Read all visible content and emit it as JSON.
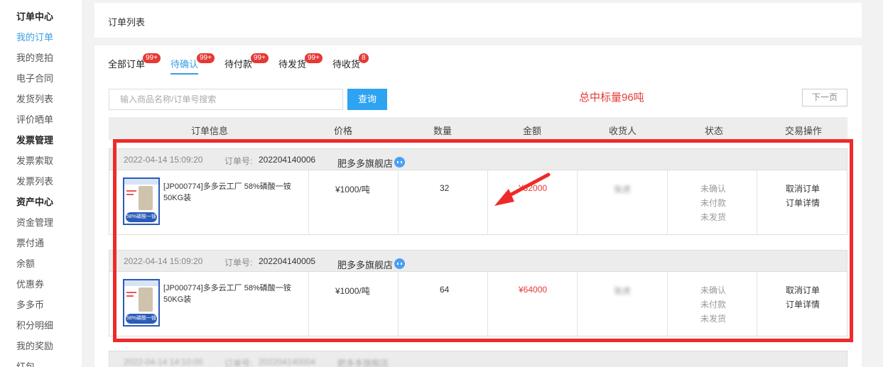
{
  "sidebar": {
    "items": [
      {
        "label": "订单中心",
        "type": "header"
      },
      {
        "label": "我的订单",
        "type": "active"
      },
      {
        "label": "我的竞拍",
        "type": "item"
      },
      {
        "label": "电子合同",
        "type": "item"
      },
      {
        "label": "发货列表",
        "type": "item"
      },
      {
        "label": "评价晒单",
        "type": "item"
      },
      {
        "label": "发票管理",
        "type": "header"
      },
      {
        "label": "发票索取",
        "type": "item"
      },
      {
        "label": "发票列表",
        "type": "item"
      },
      {
        "label": "资产中心",
        "type": "header"
      },
      {
        "label": "资金管理",
        "type": "item"
      },
      {
        "label": "票付通",
        "type": "item"
      },
      {
        "label": "余额",
        "type": "item"
      },
      {
        "label": "优惠券",
        "type": "item"
      },
      {
        "label": "多多币",
        "type": "item"
      },
      {
        "label": "积分明细",
        "type": "item"
      },
      {
        "label": "我的奖励",
        "type": "item"
      },
      {
        "label": "红包",
        "type": "item"
      }
    ]
  },
  "page": {
    "title": "订单列表"
  },
  "tabs": [
    {
      "label": "全部订单",
      "badge": "99+"
    },
    {
      "label": "待确认",
      "badge": "99+",
      "active": true
    },
    {
      "label": "待付款",
      "badge": "99+"
    },
    {
      "label": "待发货",
      "badge": "99+"
    },
    {
      "label": "待收货",
      "badge": "8"
    }
  ],
  "search": {
    "placeholder": "输入商品名称/订单号搜索",
    "value": "",
    "button_label": "查询"
  },
  "annotation": "总中标量96吨",
  "pager": {
    "next_label": "下一页"
  },
  "table": {
    "columns": [
      "订单信息",
      "价格",
      "数量",
      "金额",
      "收货人",
      "状态",
      "交易操作"
    ]
  },
  "orders": [
    {
      "date": "2022-04-14 15:09:20",
      "order_no_label": "订单号:",
      "order_no": "202204140006",
      "shop": "肥多多旗舰店",
      "product_name": "[JP000774]多多云工厂 58%磷酸一铵 50KG装",
      "thumb_text": "58%磷酸一铵",
      "price": "¥1000/吨",
      "quantity": "32",
      "amount": "¥32000",
      "receiver": "张虎",
      "status": [
        "未确认",
        "未付款",
        "未发货"
      ],
      "actions": [
        "取消订单",
        "订单详情"
      ]
    },
    {
      "date": "2022-04-14 15:09:20",
      "order_no_label": "订单号:",
      "order_no": "202204140005",
      "shop": "肥多多旗舰店",
      "product_name": "[JP000774]多多云工厂 58%磷酸一铵 50KG装",
      "thumb_text": "58%磷酸一铵",
      "price": "¥1000/吨",
      "quantity": "64",
      "amount": "¥64000",
      "receiver": "张虎",
      "status": [
        "未确认",
        "未付款",
        "未发货"
      ],
      "actions": [
        "取消订单",
        "订单详情"
      ]
    }
  ],
  "partial_order": {
    "date": "2022-04-14 14:10:00",
    "order_no_label": "订单号:",
    "order_no": "202204140004",
    "shop": "肥多多旗舰店"
  },
  "colors": {
    "accent": "#3a9ee6",
    "badge": "#e53935",
    "highlight_frame": "#ee2a2a"
  }
}
